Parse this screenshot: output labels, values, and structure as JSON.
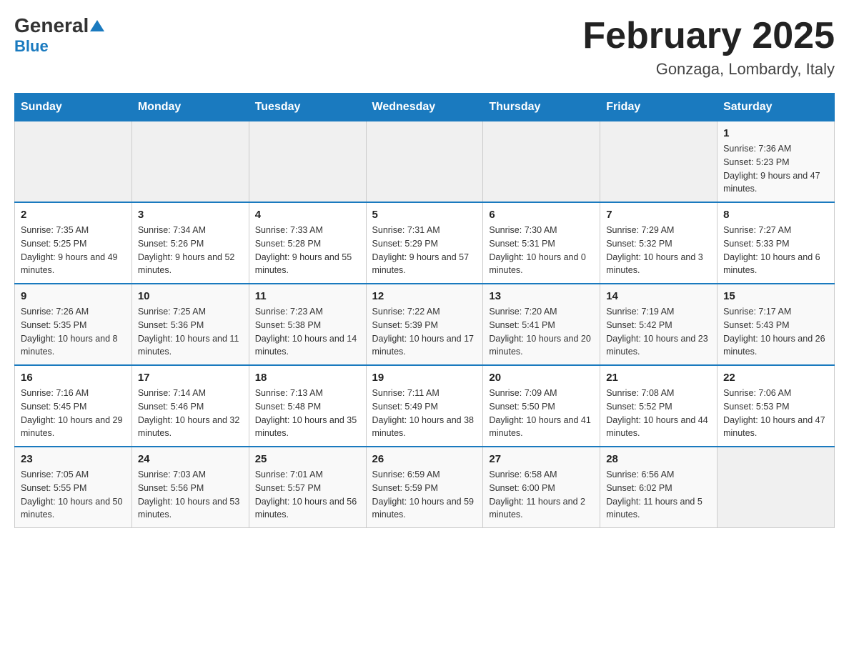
{
  "header": {
    "logo_general": "General",
    "logo_blue": "Blue",
    "title": "February 2025",
    "subtitle": "Gonzaga, Lombardy, Italy"
  },
  "days_of_week": [
    "Sunday",
    "Monday",
    "Tuesday",
    "Wednesday",
    "Thursday",
    "Friday",
    "Saturday"
  ],
  "weeks": [
    [
      {
        "day": "",
        "info": ""
      },
      {
        "day": "",
        "info": ""
      },
      {
        "day": "",
        "info": ""
      },
      {
        "day": "",
        "info": ""
      },
      {
        "day": "",
        "info": ""
      },
      {
        "day": "",
        "info": ""
      },
      {
        "day": "1",
        "info": "Sunrise: 7:36 AM\nSunset: 5:23 PM\nDaylight: 9 hours and 47 minutes."
      }
    ],
    [
      {
        "day": "2",
        "info": "Sunrise: 7:35 AM\nSunset: 5:25 PM\nDaylight: 9 hours and 49 minutes."
      },
      {
        "day": "3",
        "info": "Sunrise: 7:34 AM\nSunset: 5:26 PM\nDaylight: 9 hours and 52 minutes."
      },
      {
        "day": "4",
        "info": "Sunrise: 7:33 AM\nSunset: 5:28 PM\nDaylight: 9 hours and 55 minutes."
      },
      {
        "day": "5",
        "info": "Sunrise: 7:31 AM\nSunset: 5:29 PM\nDaylight: 9 hours and 57 minutes."
      },
      {
        "day": "6",
        "info": "Sunrise: 7:30 AM\nSunset: 5:31 PM\nDaylight: 10 hours and 0 minutes."
      },
      {
        "day": "7",
        "info": "Sunrise: 7:29 AM\nSunset: 5:32 PM\nDaylight: 10 hours and 3 minutes."
      },
      {
        "day": "8",
        "info": "Sunrise: 7:27 AM\nSunset: 5:33 PM\nDaylight: 10 hours and 6 minutes."
      }
    ],
    [
      {
        "day": "9",
        "info": "Sunrise: 7:26 AM\nSunset: 5:35 PM\nDaylight: 10 hours and 8 minutes."
      },
      {
        "day": "10",
        "info": "Sunrise: 7:25 AM\nSunset: 5:36 PM\nDaylight: 10 hours and 11 minutes."
      },
      {
        "day": "11",
        "info": "Sunrise: 7:23 AM\nSunset: 5:38 PM\nDaylight: 10 hours and 14 minutes."
      },
      {
        "day": "12",
        "info": "Sunrise: 7:22 AM\nSunset: 5:39 PM\nDaylight: 10 hours and 17 minutes."
      },
      {
        "day": "13",
        "info": "Sunrise: 7:20 AM\nSunset: 5:41 PM\nDaylight: 10 hours and 20 minutes."
      },
      {
        "day": "14",
        "info": "Sunrise: 7:19 AM\nSunset: 5:42 PM\nDaylight: 10 hours and 23 minutes."
      },
      {
        "day": "15",
        "info": "Sunrise: 7:17 AM\nSunset: 5:43 PM\nDaylight: 10 hours and 26 minutes."
      }
    ],
    [
      {
        "day": "16",
        "info": "Sunrise: 7:16 AM\nSunset: 5:45 PM\nDaylight: 10 hours and 29 minutes."
      },
      {
        "day": "17",
        "info": "Sunrise: 7:14 AM\nSunset: 5:46 PM\nDaylight: 10 hours and 32 minutes."
      },
      {
        "day": "18",
        "info": "Sunrise: 7:13 AM\nSunset: 5:48 PM\nDaylight: 10 hours and 35 minutes."
      },
      {
        "day": "19",
        "info": "Sunrise: 7:11 AM\nSunset: 5:49 PM\nDaylight: 10 hours and 38 minutes."
      },
      {
        "day": "20",
        "info": "Sunrise: 7:09 AM\nSunset: 5:50 PM\nDaylight: 10 hours and 41 minutes."
      },
      {
        "day": "21",
        "info": "Sunrise: 7:08 AM\nSunset: 5:52 PM\nDaylight: 10 hours and 44 minutes."
      },
      {
        "day": "22",
        "info": "Sunrise: 7:06 AM\nSunset: 5:53 PM\nDaylight: 10 hours and 47 minutes."
      }
    ],
    [
      {
        "day": "23",
        "info": "Sunrise: 7:05 AM\nSunset: 5:55 PM\nDaylight: 10 hours and 50 minutes."
      },
      {
        "day": "24",
        "info": "Sunrise: 7:03 AM\nSunset: 5:56 PM\nDaylight: 10 hours and 53 minutes."
      },
      {
        "day": "25",
        "info": "Sunrise: 7:01 AM\nSunset: 5:57 PM\nDaylight: 10 hours and 56 minutes."
      },
      {
        "day": "26",
        "info": "Sunrise: 6:59 AM\nSunset: 5:59 PM\nDaylight: 10 hours and 59 minutes."
      },
      {
        "day": "27",
        "info": "Sunrise: 6:58 AM\nSunset: 6:00 PM\nDaylight: 11 hours and 2 minutes."
      },
      {
        "day": "28",
        "info": "Sunrise: 6:56 AM\nSunset: 6:02 PM\nDaylight: 11 hours and 5 minutes."
      },
      {
        "day": "",
        "info": ""
      }
    ]
  ]
}
